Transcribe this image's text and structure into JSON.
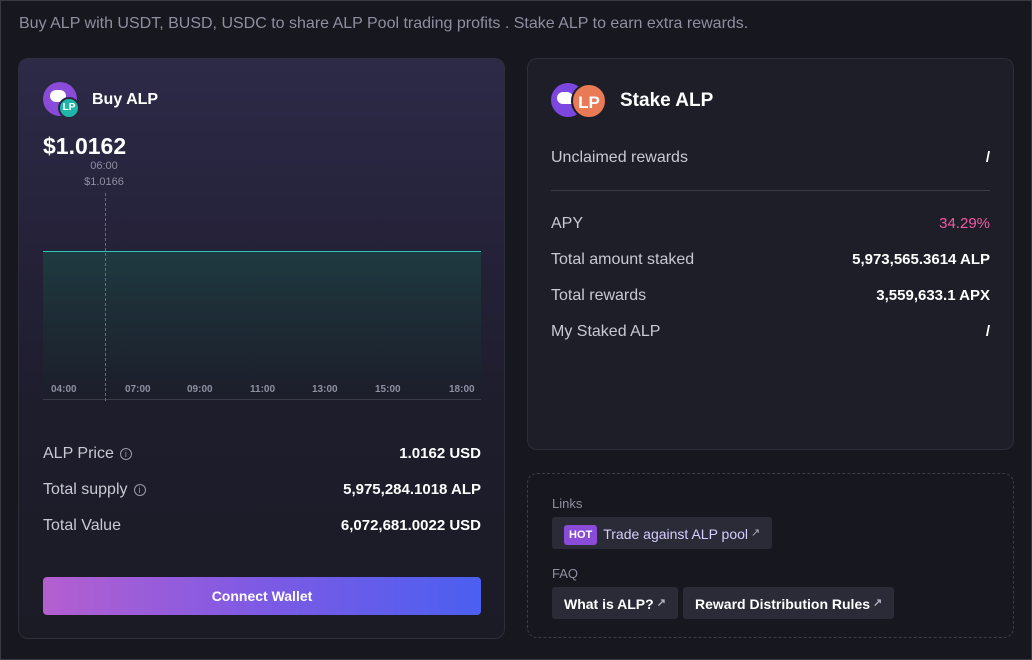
{
  "header": {
    "subtitle": "Buy ALP with USDT, BUSD, USDC to share ALP Pool trading profits . Stake ALP to earn extra rewards."
  },
  "buy": {
    "title": "Buy ALP",
    "logo_badge": "LP",
    "price": "$1.0162",
    "tooltip_time": "06:00",
    "tooltip_value": "$1.0166",
    "x_ticks": [
      "04:00",
      "07:00",
      "09:00",
      "11:00",
      "13:00",
      "15:00",
      "18:00"
    ],
    "stats": [
      {
        "label": "ALP Price",
        "value": "1.0162 USD",
        "info": true
      },
      {
        "label": "Total supply",
        "value": "5,975,284.1018 ALP",
        "info": true
      },
      {
        "label": "Total Value",
        "value": "6,072,681.0022 USD",
        "info": false
      }
    ],
    "connect_label": "Connect Wallet"
  },
  "stake": {
    "title": "Stake ALP",
    "logo_badge": "LP",
    "unclaimed_label": "Unclaimed rewards",
    "unclaimed_value": "/",
    "apy_label": "APY",
    "apy_value": "34.29%",
    "total_staked_label": "Total amount staked",
    "total_staked_value": "5,973,565.3614 ALP",
    "total_rewards_label": "Total rewards",
    "total_rewards_value": "3,559,633.1 APX",
    "my_staked_label": "My Staked ALP",
    "my_staked_value": "/"
  },
  "links": {
    "links_label": "Links",
    "hot_badge": "HOT",
    "trade_link": "Trade against ALP pool",
    "faq_label": "FAQ",
    "faq_items": [
      "What is ALP?",
      "Reward Distribution Rules"
    ]
  },
  "colors": {
    "accent_pink": "#f25aa5",
    "chart_line": "#2ec4b6",
    "button_gradient_start": "#b45fd0",
    "button_gradient_end": "#4b5ff0"
  }
}
